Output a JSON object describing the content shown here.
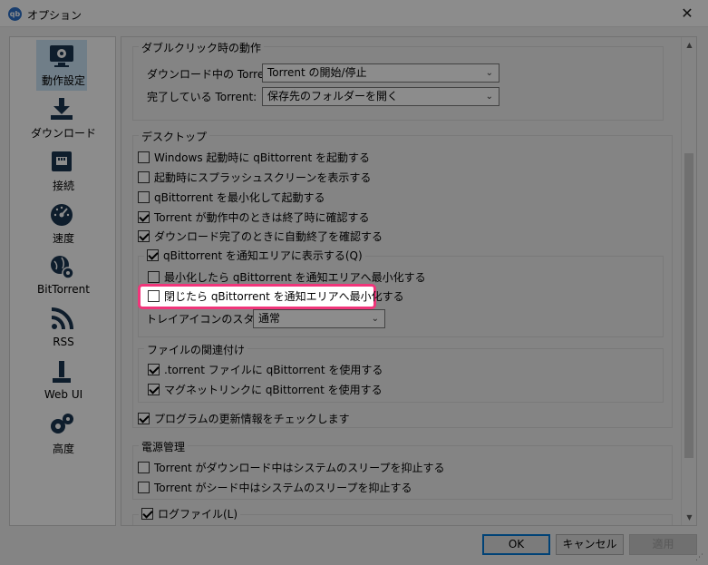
{
  "window": {
    "title": "オプション",
    "app_icon": "qb",
    "close_glyph": "✕"
  },
  "sidebar": {
    "items": [
      {
        "label": "動作設定",
        "icon": "monitor-gear-icon",
        "selected": true
      },
      {
        "label": "ダウンロード",
        "icon": "download-icon"
      },
      {
        "label": "接続",
        "icon": "network-port-icon"
      },
      {
        "label": "速度",
        "icon": "speedometer-icon"
      },
      {
        "label": "BitTorrent",
        "icon": "globe-gear-icon"
      },
      {
        "label": "RSS",
        "icon": "rss-icon"
      },
      {
        "label": "Web UI",
        "icon": "webui-icon"
      },
      {
        "label": "高度",
        "icon": "gears-icon"
      }
    ]
  },
  "doubleclick": {
    "title": "ダブルクリック時の動作",
    "downloading_label": "ダウンロード中の Torrent:",
    "downloading_value": "Torrent の開始/停止",
    "completed_label": "完了している Torrent:",
    "completed_value": "保存先のフォルダーを開く"
  },
  "desktop": {
    "title": "デスクトップ",
    "items": [
      {
        "label": "Windows 起動時に qBittorrent を起動する",
        "checked": false
      },
      {
        "label": "起動時にスプラッシュスクリーンを表示する",
        "checked": false
      },
      {
        "label": "qBittorrent を最小化して起動する",
        "checked": false
      },
      {
        "label": "Torrent が動作中のときは終了時に確認する",
        "checked": true
      },
      {
        "label": "ダウンロード完了のときに自動終了を確認する",
        "checked": true
      }
    ],
    "tray": {
      "label": "qBittorrent を通知エリアに表示する(Q)",
      "checked": true,
      "minimize_label": "最小化したら qBittorrent を通知エリアへ最小化する",
      "close_label": "閉じたら qBittorrent を通知エリアへ最小化する",
      "style_label": "トレイアイコンのスタイル:",
      "style_value": "通常"
    }
  },
  "file_assoc": {
    "title": "ファイルの関連付け",
    "torrent_label": ".torrent ファイルに qBittorrent を使用する",
    "magnet_label": "マグネットリンクに qBittorrent を使用する"
  },
  "updates": {
    "label": "プログラムの更新情報をチェックします"
  },
  "power": {
    "title": "電源管理",
    "download_label": "Torrent がダウンロード中はシステムのスリープを抑止する",
    "seed_label": "Torrent がシード中はシステムのスリープを抑止する"
  },
  "log": {
    "label": "ログファイル(L)"
  },
  "buttons": {
    "ok": "OK",
    "cancel": "キャンセル",
    "apply": "適用"
  },
  "colors": {
    "highlight": "#f0357a",
    "selected": "#cde6f7",
    "focus": "#0078d7"
  }
}
